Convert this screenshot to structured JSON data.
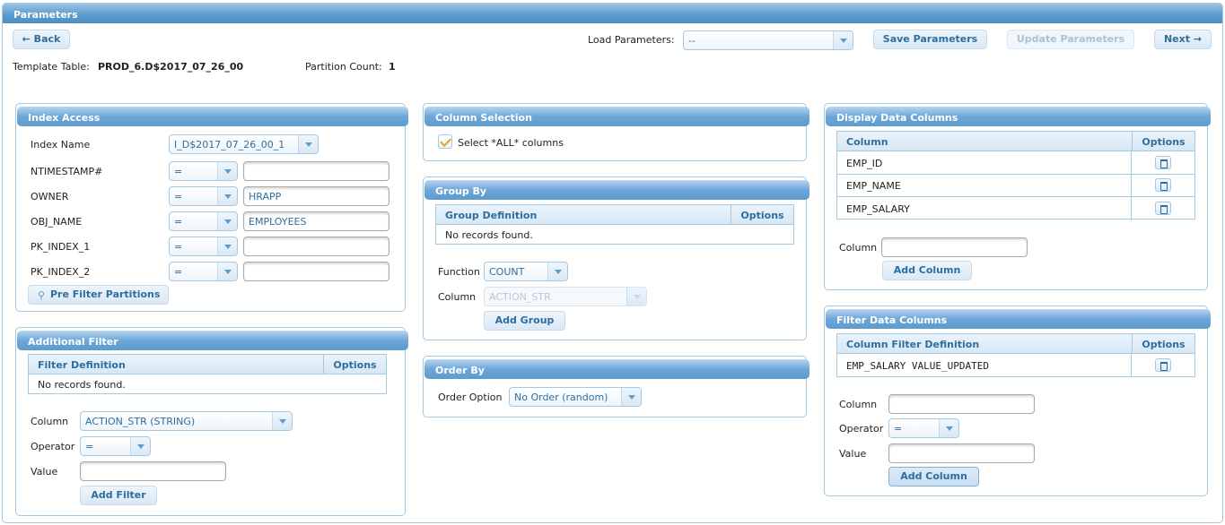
{
  "header": {
    "title": "Parameters"
  },
  "toolbar": {
    "back_label": "← Back",
    "load_params_label": "Load Parameters:",
    "load_params_value": "--",
    "save_label": "Save Parameters",
    "update_label": "Update Parameters",
    "next_label": "Next →"
  },
  "info": {
    "template_label": "Template Table:",
    "template_value": "PROD_6.D$2017_07_26_00",
    "partition_label": "Partition Count:",
    "partition_value": "1"
  },
  "index_access": {
    "title": "Index Access",
    "index_name_label": "Index Name",
    "index_name_value": "I_D$2017_07_26_00_1",
    "rows": [
      {
        "label": "NTIMESTAMP#",
        "op": "=",
        "value": ""
      },
      {
        "label": "OWNER",
        "op": "=",
        "value": "HRAPP"
      },
      {
        "label": "OBJ_NAME",
        "op": "=",
        "value": "EMPLOYEES"
      },
      {
        "label": "PK_INDEX_1",
        "op": "=",
        "value": ""
      },
      {
        "label": "PK_INDEX_2",
        "op": "=",
        "value": ""
      }
    ],
    "prefilter_label": "Pre Filter Partitions"
  },
  "additional_filter": {
    "title": "Additional Filter",
    "col_def": "Filter Definition",
    "col_opt": "Options",
    "empty": "No records found.",
    "column_label": "Column",
    "column_value": "ACTION_STR (STRING)",
    "operator_label": "Operator",
    "operator_value": "=",
    "value_label": "Value",
    "value_value": "",
    "add_label": "Add Filter"
  },
  "column_selection": {
    "title": "Column Selection",
    "select_all_label": "Select *ALL* columns",
    "select_all_checked": true
  },
  "group_by": {
    "title": "Group By",
    "col_def": "Group Definition",
    "col_opt": "Options",
    "empty": "No records found.",
    "function_label": "Function",
    "function_value": "COUNT",
    "column_label": "Column",
    "column_value": "ACTION_STR",
    "add_label": "Add Group"
  },
  "order_by": {
    "title": "Order By",
    "option_label": "Order Option",
    "option_value": "No Order (random)"
  },
  "display_columns": {
    "title": "Display Data Columns",
    "col_name": "Column",
    "col_opt": "Options",
    "rows": [
      "EMP_ID",
      "EMP_NAME",
      "EMP_SALARY"
    ],
    "column_label": "Column",
    "column_value": "",
    "add_label": "Add Column"
  },
  "filter_columns": {
    "title": "Filter Data Columns",
    "col_def": "Column Filter Definition",
    "col_opt": "Options",
    "rows": [
      "EMP_SALARY VALUE_UPDATED"
    ],
    "column_label": "Column",
    "column_value": "",
    "operator_label": "Operator",
    "operator_value": "=",
    "value_label": "Value",
    "value_value": "",
    "add_label": "Add Column"
  },
  "icons": {
    "trash": "trash-icon",
    "bulb": "lightbulb-icon",
    "check": "check-icon",
    "dropdown": "chevron-down-icon"
  },
  "colors": {
    "accent": "#5c9ccc",
    "text_link": "#2e6e9e",
    "border": "#a6c9e2",
    "check": "#e8a317"
  }
}
